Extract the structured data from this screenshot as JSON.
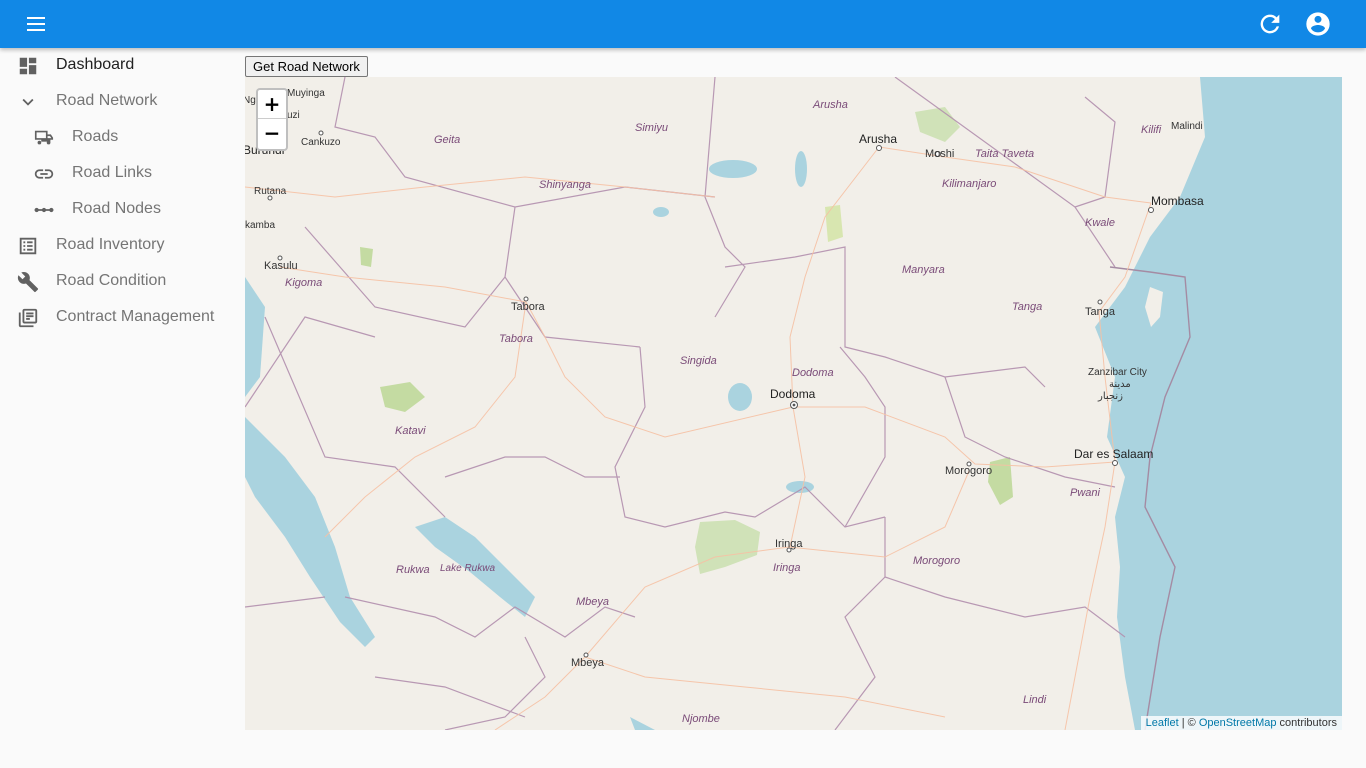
{
  "header": {
    "menu_icon": "menu-icon",
    "refresh_icon": "refresh-icon",
    "account_icon": "account-circle-icon",
    "bg_color": "#1188e6"
  },
  "sidebar": {
    "items": [
      {
        "label": "Dashboard",
        "icon": "dashboard-icon"
      },
      {
        "label": "Road Network",
        "icon": "chevron-down-icon"
      },
      {
        "label": "Roads",
        "icon": "car-icon"
      },
      {
        "label": "Road Links",
        "icon": "link-icon"
      },
      {
        "label": "Road Nodes",
        "icon": "nodes-icon"
      },
      {
        "label": "Road Inventory",
        "icon": "list-icon"
      },
      {
        "label": "Road Condition",
        "icon": "wrench-icon"
      },
      {
        "label": "Contract Management",
        "icon": "library-icon"
      }
    ]
  },
  "toolbar": {
    "get_network_label": "Get Road Network"
  },
  "map": {
    "zoom_in": "+",
    "zoom_out": "−",
    "attribution": {
      "leaflet": "Leaflet",
      "sep": " | © ",
      "osm": "OpenStreetMap",
      "suffix": " contributors"
    },
    "cities": {
      "arusha": "Arusha",
      "moshi": "Moshi",
      "mombasa": "Mombasa",
      "malindi": "Malindi",
      "tanga": "Tanga",
      "dodoma": "Dodoma",
      "dar": "Dar es Salaam",
      "morogoro": "Morogoro",
      "iringa": "Iringa",
      "mbeya": "Mbeya",
      "tabora": "Tabora",
      "kasulu": "Kasulu",
      "kibondo": "Muyinga",
      "cankuzo": "Cankuzo",
      "rutana": "Rutana",
      "zanzibar": "Zanzibar City",
      "zanzibar_ar": "مدينة",
      "zanzibar_ar2": "زنجبار",
      "kamba": "kamba",
      "burundi": "Burundi",
      "uzi": "uzi",
      "ngo": "Ngo"
    },
    "regions": {
      "arusha": "Arusha",
      "simiyu": "Simiyu",
      "geita": "Geita",
      "shinyanga": "Shinyanga",
      "kilifi": "Kilifi",
      "taita": "Taita Taveta",
      "kilimanjaro": "Kilimanjaro",
      "kwale": "Kwale",
      "manyara": "Manyara",
      "tanga": "Tanga",
      "kigoma": "Kigoma",
      "tabora": "Tabora",
      "singida": "Singida",
      "dodoma": "Dodoma",
      "katavi": "Katavi",
      "pwani": "Pwani",
      "morogoro": "Morogoro",
      "iringa": "Iringa",
      "rukwa": "Rukwa",
      "lake_rukwa": "Lake Rukwa",
      "mbeya": "Mbeya",
      "lindi": "Lindi",
      "njombe": "Njombe"
    },
    "colors": {
      "land": "#f2efe9",
      "water": "#aad3df",
      "border": "#a48ba3",
      "park": "#d0e2b8",
      "road": "#f6c1a4"
    }
  }
}
